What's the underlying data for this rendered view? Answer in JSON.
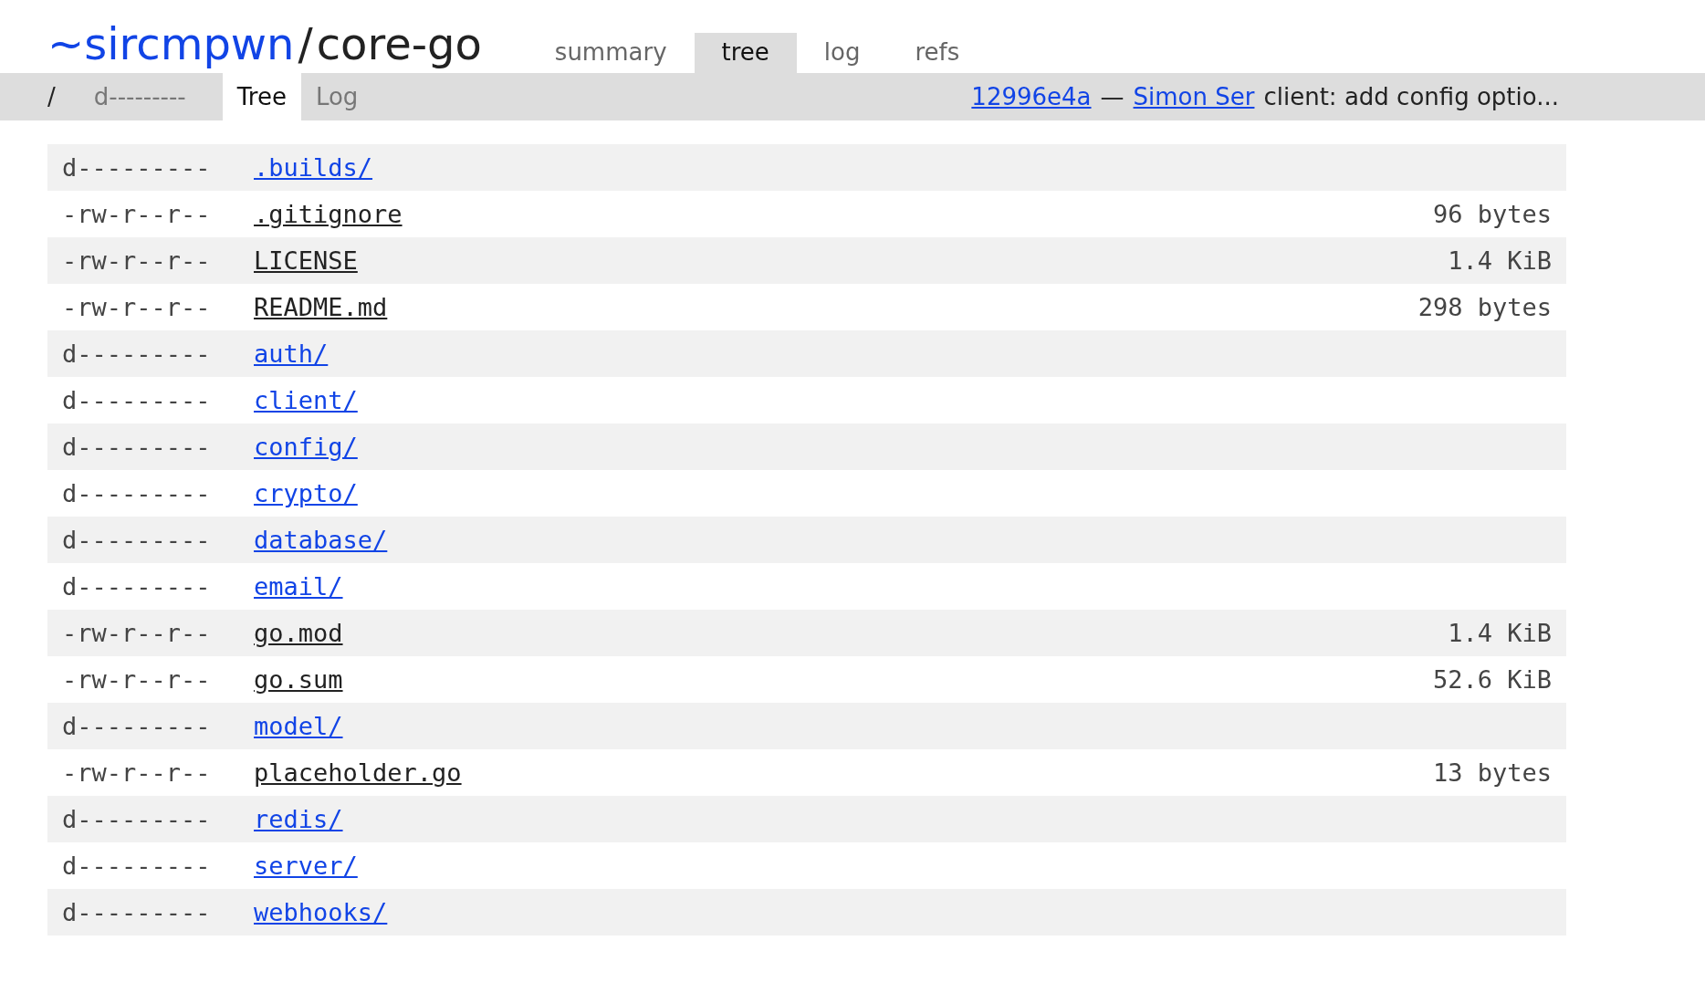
{
  "header": {
    "owner": "~sircmpwn",
    "separator": "/",
    "repo": "core-go"
  },
  "nav_tabs": [
    {
      "label": "summary",
      "selected": false
    },
    {
      "label": "tree",
      "selected": true
    },
    {
      "label": "log",
      "selected": false
    },
    {
      "label": "refs",
      "selected": false
    }
  ],
  "subnav": {
    "path": "/",
    "mode": "d---------",
    "tabs": [
      {
        "label": "Tree",
        "selected": true
      },
      {
        "label": "Log",
        "selected": false
      }
    ],
    "commit": {
      "hash": "12996e4a",
      "dash": "—",
      "author": "Simon Ser",
      "message": "client: add config optio..."
    }
  },
  "files": [
    {
      "mode": "d---------",
      "name": ".builds/",
      "kind": "dir"
    },
    {
      "mode": "-rw-r--r--",
      "name": ".gitignore",
      "kind": "file",
      "size": "96 bytes"
    },
    {
      "mode": "-rw-r--r--",
      "name": "LICENSE",
      "kind": "file",
      "size": "1.4 KiB"
    },
    {
      "mode": "-rw-r--r--",
      "name": "README.md",
      "kind": "file",
      "size": "298 bytes"
    },
    {
      "mode": "d---------",
      "name": "auth/",
      "kind": "dir"
    },
    {
      "mode": "d---------",
      "name": "client/",
      "kind": "dir"
    },
    {
      "mode": "d---------",
      "name": "config/",
      "kind": "dir"
    },
    {
      "mode": "d---------",
      "name": "crypto/",
      "kind": "dir"
    },
    {
      "mode": "d---------",
      "name": "database/",
      "kind": "dir"
    },
    {
      "mode": "d---------",
      "name": "email/",
      "kind": "dir"
    },
    {
      "mode": "-rw-r--r--",
      "name": "go.mod",
      "kind": "file",
      "size": "1.4 KiB"
    },
    {
      "mode": "-rw-r--r--",
      "name": "go.sum",
      "kind": "file",
      "size": "52.6 KiB"
    },
    {
      "mode": "d---------",
      "name": "model/",
      "kind": "dir"
    },
    {
      "mode": "-rw-r--r--",
      "name": "placeholder.go",
      "kind": "file",
      "size": "13 bytes"
    },
    {
      "mode": "d---------",
      "name": "redis/",
      "kind": "dir"
    },
    {
      "mode": "d---------",
      "name": "server/",
      "kind": "dir"
    },
    {
      "mode": "d---------",
      "name": "webhooks/",
      "kind": "dir"
    }
  ]
}
